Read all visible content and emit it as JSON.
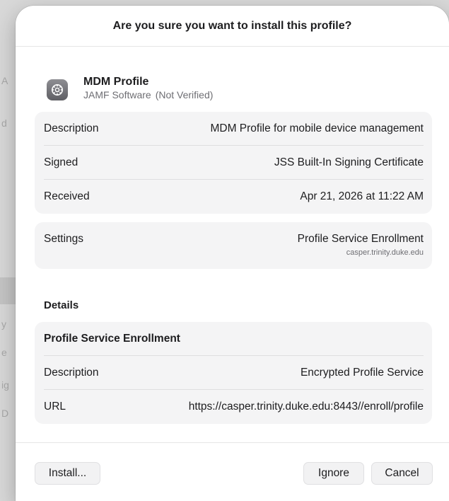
{
  "dialog": {
    "title": "Are you sure you want to install this profile?"
  },
  "profile": {
    "icon": "gear-icon",
    "name": "MDM Profile",
    "publisher": "JAMF Software",
    "verification": "(Not Verified)"
  },
  "info_rows": [
    {
      "label": "Description",
      "value": "MDM Profile for mobile device management"
    },
    {
      "label": "Signed",
      "value": "JSS Built-In Signing Certificate"
    },
    {
      "label": "Received",
      "value": "Apr 21, 2026 at 11:22 AM"
    }
  ],
  "settings": {
    "label": "Settings",
    "value": "Profile Service Enrollment",
    "host": "casper.trinity.duke.edu"
  },
  "details": {
    "heading": "Details",
    "section_title": "Profile Service Enrollment",
    "rows": [
      {
        "label": "Description",
        "value": "Encrypted Profile Service"
      },
      {
        "label": "URL",
        "value": "https://casper.trinity.duke.edu:8443//enroll/profile"
      }
    ]
  },
  "buttons": {
    "install": "Install...",
    "ignore": "Ignore",
    "cancel": "Cancel"
  },
  "background_letters": [
    "A",
    "d",
    "y",
    "e",
    "ig",
    "D"
  ]
}
